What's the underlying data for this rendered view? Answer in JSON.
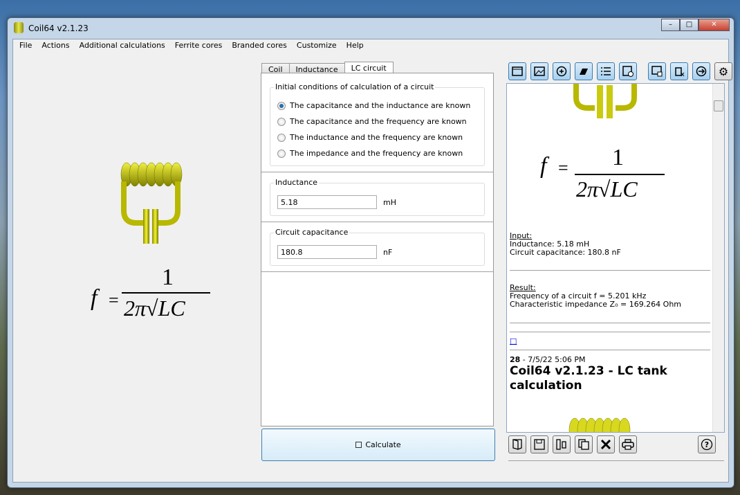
{
  "window": {
    "title": "Coil64 v2.1.23",
    "minimize": "–",
    "maximize": "□",
    "close": "✕"
  },
  "menu": [
    "File",
    "Actions",
    "Additional calculations",
    "Ferrite cores",
    "Branded cores",
    "Customize",
    "Help"
  ],
  "tabs": [
    "Coil",
    "Inductance",
    "LC circuit"
  ],
  "conditions": {
    "title": "Initial conditions of calculation of a circuit",
    "options": [
      "The capacitance and the inductance are known",
      "The capacitance and the frequency are known",
      "The inductance and the frequency are known",
      "The impedance and the frequency are known"
    ],
    "selected": 0
  },
  "inductance": {
    "label": "Inductance",
    "value": "5.18",
    "unit": "mH"
  },
  "capacitance": {
    "label": "Circuit capacitance",
    "value": "180.8",
    "unit": "nF"
  },
  "calculate_label": "Calculate",
  "formula": {
    "f": "f",
    "eq": "=",
    "num": "1",
    "den": "2π√LC"
  },
  "result_view": {
    "input_header": "Input:",
    "input_lines": [
      "Inductance: 5.18 mH",
      "Circuit capacitance: 180.8 nF"
    ],
    "result_header": "Result:",
    "result_lines": [
      "Frequency of a circuit f = 5.201 kHz",
      "Characteristic impedance Z₀ = 169.264 Ohm"
    ],
    "link": "□",
    "entry_num": "28",
    "entry_date": " - 7/5/22 5:06 PM",
    "entry_title": "Coil64 v2.1.23 - LC tank calculation"
  },
  "top_toolbar": [
    "window-icon",
    "image-icon",
    "add-circle-icon",
    "ltspice-icon",
    "list-icon",
    "save-check-icon",
    "window-delete-icon",
    "trash-x-icon",
    "export-icon",
    "gear-icon"
  ],
  "bottom_toolbar": [
    "open-icon",
    "save-icon",
    "columns-icon",
    "copy-icon",
    "close-x-icon",
    "print-icon",
    "help-icon"
  ]
}
